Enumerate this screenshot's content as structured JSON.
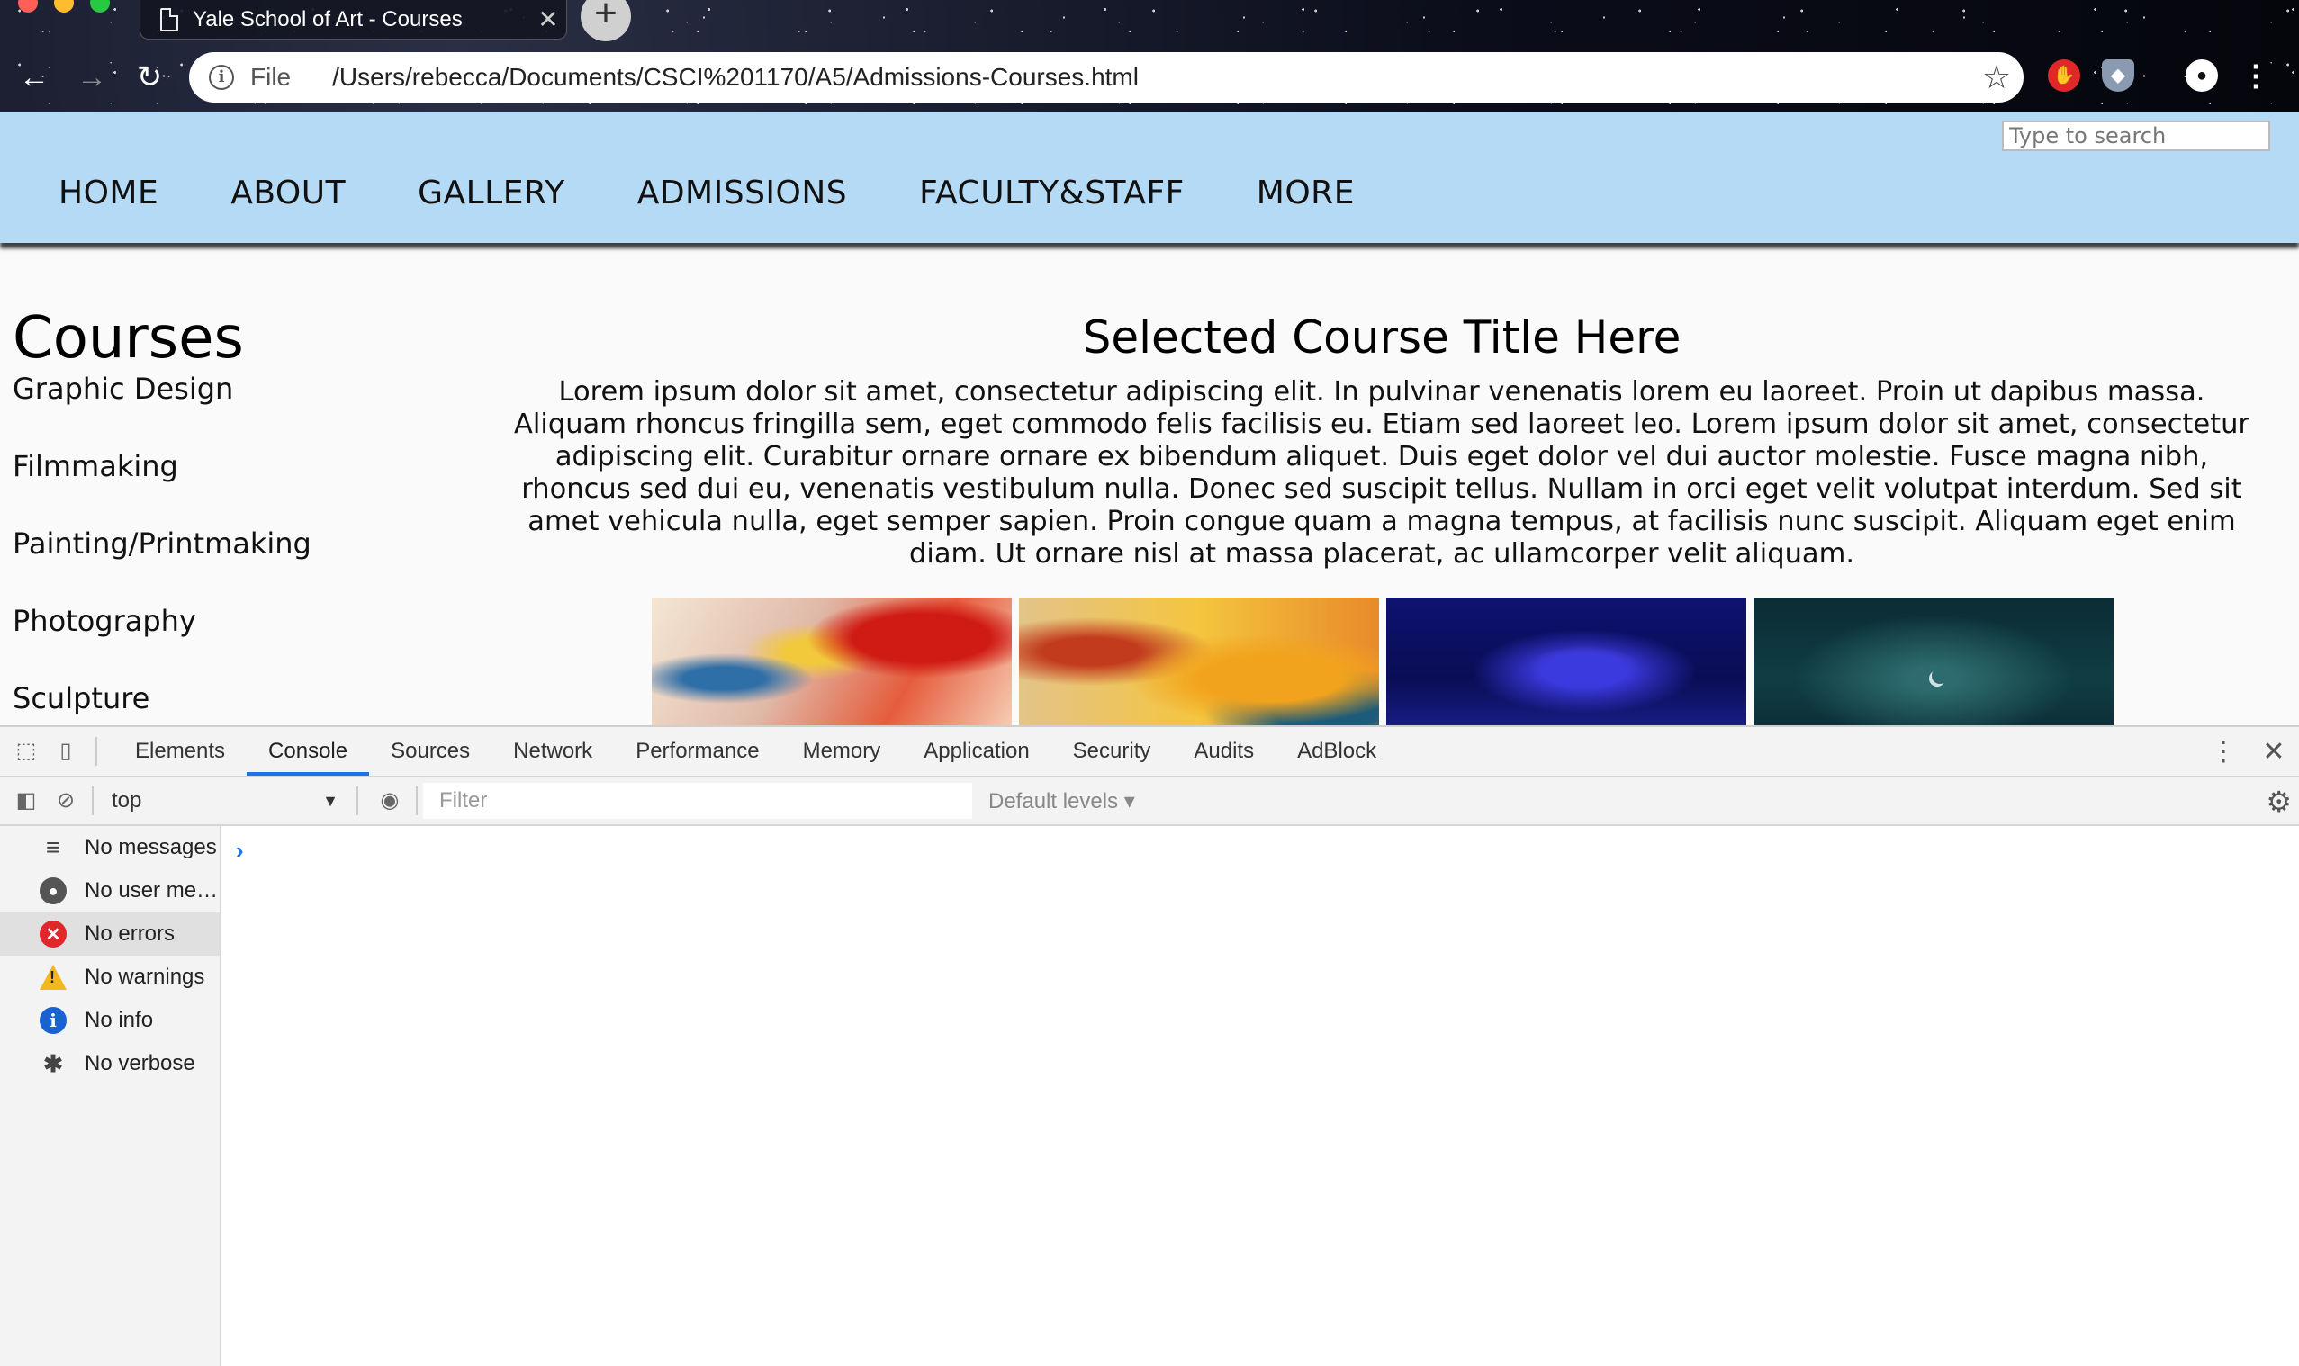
{
  "browser": {
    "tab_title": "Yale School of Art - Courses",
    "tab_close": "✕",
    "new_tab": "+",
    "back": "←",
    "forward": "→",
    "reload": "↻",
    "scheme_label": "File",
    "url": "/Users/rebecca/Documents/CSCI%201170/A5/Admissions-Courses.html",
    "info_glyph": "i",
    "bookmark": "☆"
  },
  "site": {
    "search_placeholder": "Type to search",
    "nav": [
      "HOME",
      "ABOUT",
      "GALLERY",
      "ADMISSIONS",
      "FACULTY&STAFF",
      "MORE"
    ],
    "sidebar_title": "Courses",
    "courses": [
      "Graphic Design",
      "Filmmaking",
      "Painting/Printmaking",
      "Photography",
      "Sculpture"
    ],
    "course_title": "Selected Course Title Here",
    "course_body": "Lorem ipsum dolor sit amet, consectetur adipiscing elit. In pulvinar venenatis lorem eu laoreet. Proin ut dapibus massa. Aliquam rhoncus fringilla sem, eget commodo felis facilisis eu. Etiam sed laoreet leo. Lorem ipsum dolor sit amet, consectetur adipiscing elit. Curabitur ornare ornare ex bibendum aliquet. Duis eget dolor vel dui auctor molestie. Fusce magna nibh, rhoncus sed dui eu, venenatis vestibulum nulla. Donec sed suscipit tellus. Nullam in orci eget velit volutpat interdum. Sed sit amet vehicula nulla, eget semper sapien. Proin congue quam a magna tempus, at facilisis nunc suscipit. Aliquam eget enim diam. Ut ornare nisl at massa placerat, ac ullamcorper velit aliquam."
  },
  "devtools": {
    "tabs": [
      "Elements",
      "Console",
      "Sources",
      "Network",
      "Performance",
      "Memory",
      "Application",
      "Security",
      "Audits",
      "AdBlock"
    ],
    "active_tab": "Console",
    "context": "top",
    "filter_placeholder": "Filter",
    "levels": "Default levels ▾",
    "sidebar": [
      {
        "label": "No messages",
        "icon": "list-icon"
      },
      {
        "label": "No user me…",
        "icon": "user-icon"
      },
      {
        "label": "No errors",
        "icon": "error-icon"
      },
      {
        "label": "No warnings",
        "icon": "warning-icon"
      },
      {
        "label": "No info",
        "icon": "info-icon"
      },
      {
        "label": "No verbose",
        "icon": "bug-icon"
      }
    ],
    "prompt": "›"
  },
  "colors": {
    "navbar": "#b5daf6",
    "devtools_accent": "#1a73e8",
    "error": "#e0282c",
    "warning": "#f2b81e",
    "info": "#1a62d0"
  }
}
